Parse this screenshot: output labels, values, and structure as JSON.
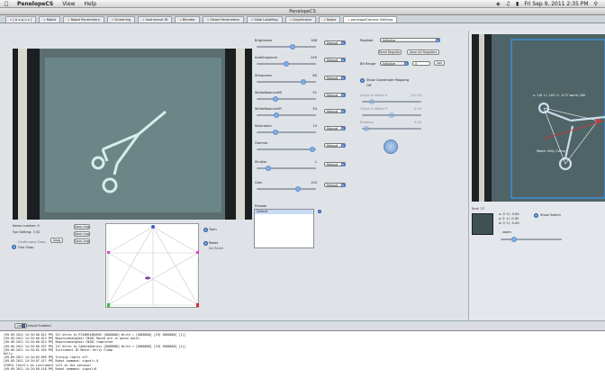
{
  "menubar": {
    "app": "PenelopeCS",
    "items": [
      "View",
      "Help"
    ],
    "clock": "Fri Sep 9, 2011  2:35 PM"
  },
  "window": {
    "title": "PenelopeCS"
  },
  "tabs": [
    {
      "label": "[ b o g u s ]"
    },
    {
      "label": "Robot"
    },
    {
      "label": "Robot Parameters"
    },
    {
      "label": "Screening"
    },
    {
      "label": "Instrument ID"
    },
    {
      "label": "Blender"
    },
    {
      "label": "Vision Parameters"
    },
    {
      "label": "Slide Labelling"
    },
    {
      "label": "Graphicator"
    },
    {
      "label": "Notes"
    },
    {
      "label": "penelopeCamera Settings"
    }
  ],
  "left": {
    "items_number": "Items number: 0",
    "fps_setting": "Fps Setting: 7.50",
    "continuous_snap": "Continuous Snap",
    "one_snap": "One Snap",
    "snap_btn": "Snap",
    "save_btn_1": "Save Img",
    "save_btn_2": "Save Img",
    "save_btn_3": "Save Img",
    "train_label": "Train",
    "reset_label": "Reset",
    "no_reset": "No Reset"
  },
  "sliders": [
    {
      "label": "Brightness",
      "value": "168",
      "pos": 0.62
    },
    {
      "label": "AutoExposure",
      "value": "249",
      "pos": 0.5
    },
    {
      "label": "Sharpness",
      "value": "80",
      "pos": 0.82
    },
    {
      "label": "WhiteBalanceUB",
      "value": "51",
      "pos": 0.3
    },
    {
      "label": "WhiteBalanceVR",
      "value": "54",
      "pos": 0.32
    },
    {
      "label": "Saturation",
      "value": "10",
      "pos": 0.3
    },
    {
      "label": "Gamma",
      "value": "",
      "pos": 0.98
    },
    {
      "label": "Shutter",
      "value": "1",
      "pos": 0.17
    },
    {
      "label": "Gain",
      "value": "100",
      "pos": 0.72
    }
  ],
  "manual_label": "Manual",
  "presets": {
    "label": "Presets",
    "item": "Default"
  },
  "register": {
    "label": "Register",
    "value": "Initialize",
    "read_btn": "Read Register",
    "save_btn": "Save All Registers",
    "bit_range_label": "Bit Range",
    "bit_range_value": "Initialize",
    "bit_value": "0",
    "set_btn": "Set"
  },
  "coords": {
    "show_label": "Show Coordinate Mapping",
    "off_label": "Off",
    "a_label": "Origin in World X",
    "a_val": "142.55",
    "b_label": "Origin in World Y",
    "b_val": "0.00",
    "c_label": "Rotation",
    "c_val": "0.00"
  },
  "right": {
    "overlay_text": "x: 118 +/- 249 +/- -0.37 world: 280",
    "watch_text": "Watch: Kelly Clamp",
    "info_l1": "Smt: 27",
    "info_l2": "x: 0 +/- 0.00",
    "info_l3": "y: 0 +/- 0.00",
    "info_l4": "a: 0 +/- 0.00",
    "show_switch": "Show Switch",
    "zoom_label": "zoom"
  },
  "bottom": {
    "clear_btn": "Clear",
    "output_enabled": "Output Enabled"
  },
  "console_lines": [
    "[09-09-2011 14:34:00.812 PM]  I2C  Write to RT4ARR44N4E8S [8888888]    Write = [8888888] [29] 8888888] [1]]",
    "[09-09-2011 14:34:00.813 PM]  BeginLoadingGoal CNZQC   Moved are in pause point.",
    "[09-09-2011 14:34:00.813 PM]  BeginLoadingGoal CNZQC   Completed",
    "[09-09-2011 14:34:00.937 PM]  I2C  Write to CameraAddress [8888888]    Write = [8888888] [29] 8888888] [1]]",
    "[09-09-2011 14:34:02.945 PM]  Instrument ID Match: Kelly Clamp",
    "Kelly",
    "[09-09-2011 14:34:03.899 PM]  Turning lights off.",
    "[09-09-2011 14:34:07.417 PM]     Robot command: signal=-0",
    "SCHEG> there's an instrument left on the conveyor",
    "[09-09-2011 14:34:09.418 PM]     Robot command: signal=0"
  ],
  "colors": {
    "accent": "#3a73c0",
    "video_bg": "#4b5f62"
  }
}
